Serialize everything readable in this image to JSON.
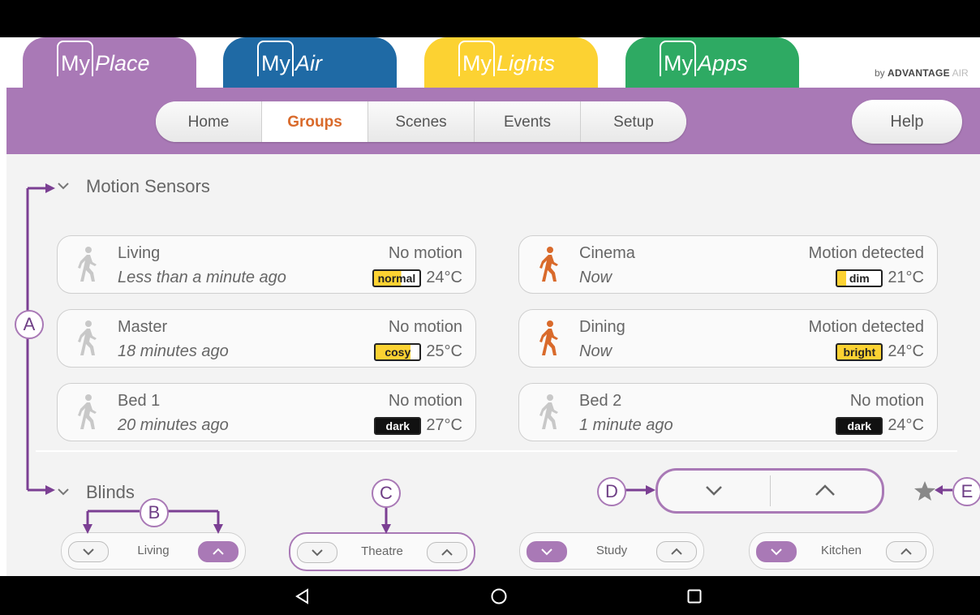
{
  "apps": {
    "myplace": {
      "prefix": "My",
      "word": "Place"
    },
    "myair": {
      "prefix": "My",
      "word": "Air"
    },
    "mylights": {
      "prefix": "My",
      "word": "Lights"
    },
    "myapps": {
      "prefix": "My",
      "word": "Apps"
    }
  },
  "byline": {
    "by": "by",
    "brand": "ADVANTAGE",
    "air": "AIR"
  },
  "nav": {
    "home": "Home",
    "groups": "Groups",
    "scenes": "Scenes",
    "events": "Events",
    "setup": "Setup",
    "help": "Help"
  },
  "motion_section": {
    "title": "Motion Sensors"
  },
  "sensors": [
    {
      "name": "Living",
      "ago": "Less than a minute ago",
      "status": "No motion",
      "light": "normal",
      "temp": "24°C"
    },
    {
      "name": "Cinema",
      "ago": "Now",
      "status": "Motion detected",
      "light": "dim",
      "temp": "21°C"
    },
    {
      "name": "Master",
      "ago": "18 minutes ago",
      "status": "No motion",
      "light": "cosy",
      "temp": "25°C"
    },
    {
      "name": "Dining",
      "ago": "Now",
      "status": "Motion detected",
      "light": "bright",
      "temp": "24°C"
    },
    {
      "name": "Bed 1",
      "ago": "20 minutes ago",
      "status": "No motion",
      "light": "dark",
      "temp": "27°C"
    },
    {
      "name": "Bed 2",
      "ago": "1 minute ago",
      "status": "No motion",
      "light": "dark",
      "temp": "24°C"
    }
  ],
  "blinds_section": {
    "title": "Blinds"
  },
  "blinds": [
    {
      "name": "Living"
    },
    {
      "name": "Theatre"
    },
    {
      "name": "Study"
    },
    {
      "name": "Kitchen"
    }
  ],
  "callouts": {
    "a": "A",
    "b": "B",
    "c": "C",
    "d": "D",
    "e": "E"
  },
  "colors": {
    "myplace": "#a979b6",
    "myair": "#1f6aa5",
    "mylights": "#fcd232",
    "myapps": "#2eaa63",
    "active_tab": "#d96a2b",
    "motion_on": "#d96a2b",
    "motion_off": "#c8c8c8"
  }
}
